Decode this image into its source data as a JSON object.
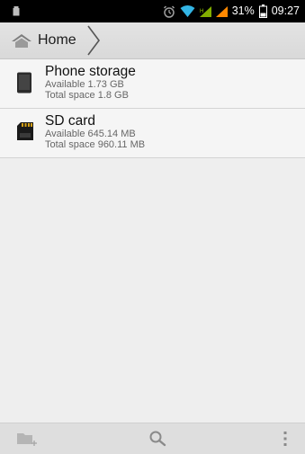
{
  "status_bar": {
    "battery_percent": "31%",
    "time": "09:27",
    "icons": [
      "notification-icon",
      "alarm-icon",
      "wifi-icon",
      "signal-icon",
      "signal-icon",
      "battery-icon"
    ]
  },
  "action_bar": {
    "breadcrumb": "Home",
    "home_icon": "home-icon"
  },
  "storage": [
    {
      "title": "Phone storage",
      "available": "Available 1.73 GB",
      "total": "Total space 1.8 GB",
      "icon": "phone-icon"
    },
    {
      "title": "SD card",
      "available": "Available 645.14 MB",
      "total": "Total space 960.11 MB",
      "icon": "sd-card-icon"
    }
  ],
  "bottom_bar": {
    "icons": [
      "new-folder-icon",
      "search-icon",
      "overflow-menu-icon"
    ]
  },
  "colors": {
    "status_bar": "#000000",
    "action_bar": "#dcdcdc",
    "list_background": "#f5f5f5",
    "page_background": "#eeeeee",
    "bottom_bar": "#dedede",
    "wifi_accent": "#33b5e5",
    "signal_accent": "#99cc00",
    "signal_strong": "#ff8800"
  }
}
